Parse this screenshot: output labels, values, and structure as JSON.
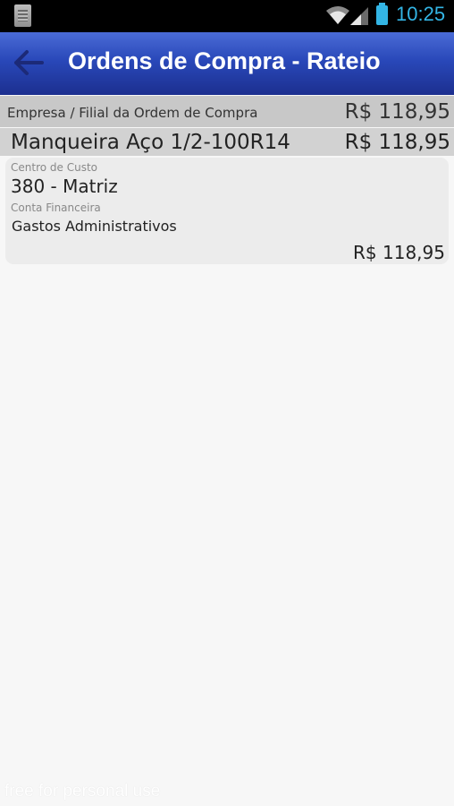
{
  "status_bar": {
    "time": "10:25"
  },
  "action_bar": {
    "title": "Ordens de Compra - Rateio"
  },
  "header_row": {
    "label": "Empresa / Filial da Ordem de Compra",
    "value": "R$ 118,95"
  },
  "item_row": {
    "label": "Manqueira Aço 1/2-100R14",
    "value": "R$ 118,95"
  },
  "allocation": {
    "cost_center_label": "Centro de Custo",
    "cost_center_value": "380 - Matriz",
    "account_label": "Conta Financeira",
    "account_value": "Gastos Administrativos",
    "amount": "R$ 118,95"
  },
  "watermark": "free for personal use",
  "colors": {
    "action_bar": "#2948b9",
    "accent": "#33b5e5"
  }
}
